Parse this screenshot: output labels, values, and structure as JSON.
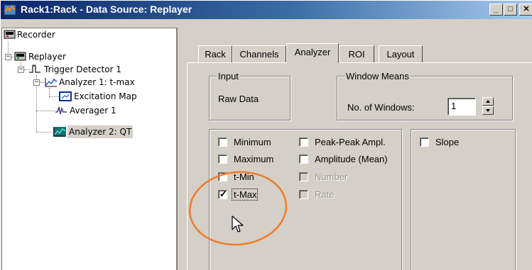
{
  "window": {
    "title": "Rack1:Rack - Data Source: Replayer",
    "buttons": [
      "minimize",
      "maximize",
      "close"
    ]
  },
  "tree": {
    "items": [
      {
        "label": "Recorder",
        "icon": "recorder-icon"
      },
      {
        "label": "Replayer",
        "icon": "replayer-icon"
      },
      {
        "label": "Trigger Detector 1",
        "icon": "trigger-detector-icon"
      },
      {
        "label": "Analyzer 1: t-max",
        "icon": "analyzer-icon"
      },
      {
        "label": "Excitation Map",
        "icon": "excitation-map-icon"
      },
      {
        "label": "Averager 1",
        "icon": "averager-icon"
      },
      {
        "label": "Analyzer 2: QT",
        "icon": "analyzer-icon",
        "selected": true
      }
    ]
  },
  "tabs": [
    {
      "label": "Rack"
    },
    {
      "label": "Channels"
    },
    {
      "label": "Analyzer",
      "active": true
    },
    {
      "label": "ROI"
    },
    {
      "label": "Layout"
    }
  ],
  "input_group": {
    "legend": "Input",
    "value": "Raw Data"
  },
  "window_means_group": {
    "legend": "Window Means",
    "label": "No. of Windows:",
    "value": "1"
  },
  "checks_left": [
    {
      "label": "Minimum",
      "checked": false,
      "enabled": true
    },
    {
      "label": "Maximum",
      "checked": false,
      "enabled": true
    },
    {
      "label": "t-Min",
      "checked": false,
      "enabled": true
    },
    {
      "label": "t-Max",
      "checked": true,
      "enabled": true
    }
  ],
  "checks_mid": [
    {
      "label": "Peak-Peak Ampl.",
      "checked": false,
      "enabled": true
    },
    {
      "label": "Amplitude (Mean)",
      "checked": false,
      "enabled": true
    },
    {
      "label": "Number",
      "checked": false,
      "enabled": false
    },
    {
      "label": "Rate",
      "checked": false,
      "enabled": false
    }
  ],
  "checks_right": [
    {
      "label": "Slope",
      "checked": false,
      "enabled": true
    }
  ],
  "colors": {
    "titlebar_start": "#0a246a",
    "titlebar_end": "#a6caf0",
    "highlight_ellipse": "#f07b2a",
    "face": "#d4d0c8"
  }
}
